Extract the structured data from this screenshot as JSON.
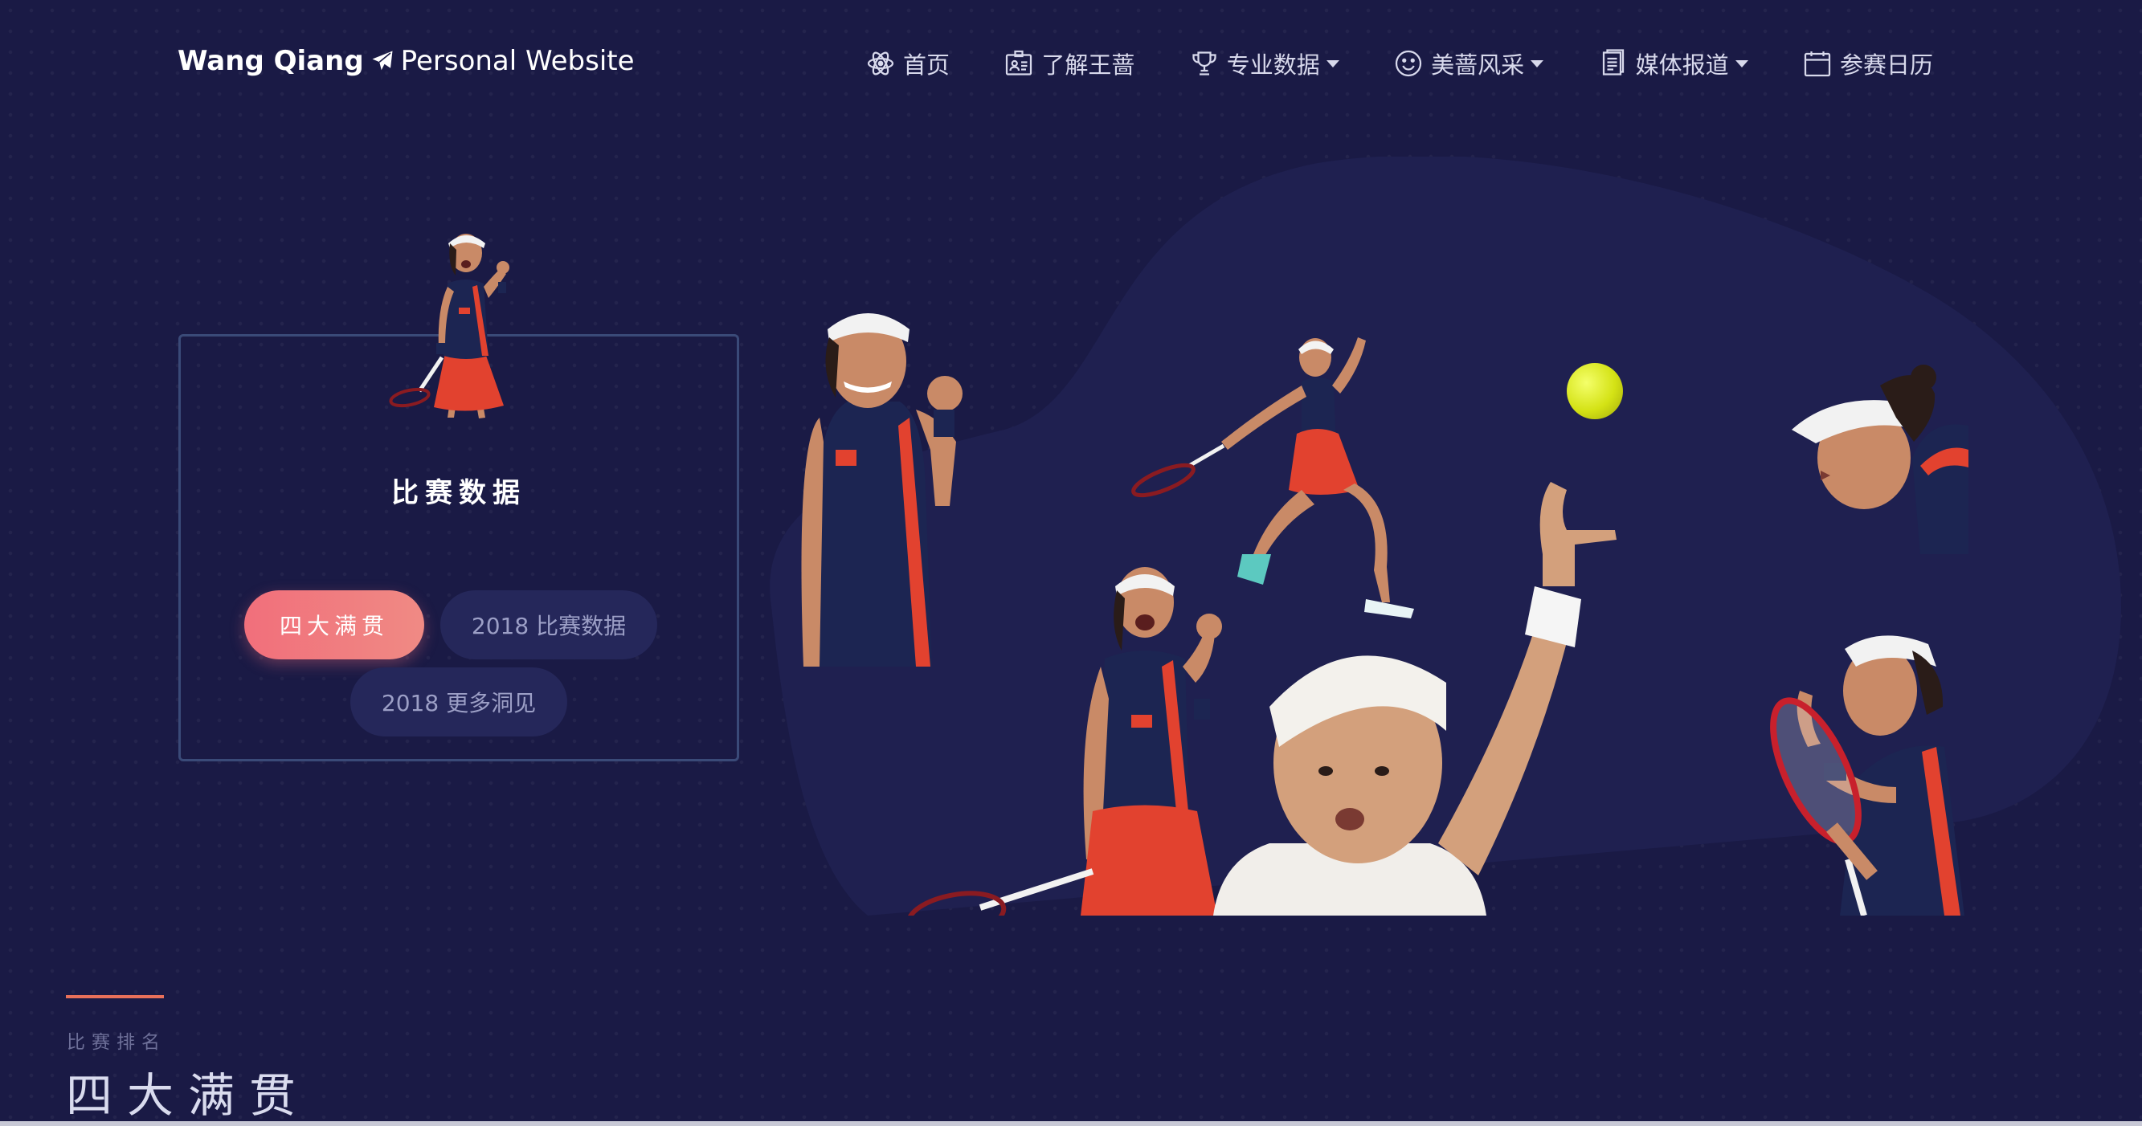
{
  "brand": {
    "name": "Wang Qiang",
    "subtitle": "Personal Website",
    "icon": "paper-plane-icon"
  },
  "nav": [
    {
      "label": "首页",
      "icon": "atom-icon",
      "dropdown": false
    },
    {
      "label": "了解王蔷",
      "icon": "id-card-icon",
      "dropdown": false
    },
    {
      "label": "专业数据",
      "icon": "trophy-icon",
      "dropdown": true
    },
    {
      "label": "美蔷风采",
      "icon": "smile-icon",
      "dropdown": true
    },
    {
      "label": "媒体报道",
      "icon": "document-icon",
      "dropdown": true
    },
    {
      "label": "参赛日历",
      "icon": "calendar-icon",
      "dropdown": false
    }
  ],
  "card": {
    "title": "比赛数据",
    "buttons": [
      {
        "label": "四大满贯",
        "active": true
      },
      {
        "label": "2018 比赛数据",
        "active": false
      },
      {
        "label": "2018 更多洞见",
        "active": false
      }
    ]
  },
  "section": {
    "subtitle": "比赛排名",
    "title": "四大满贯"
  },
  "colors": {
    "background": "#1a1a45",
    "accent": "#f16f7b",
    "blob": "#1f2050",
    "navy_kit": "#1c2552",
    "red_kit": "#e2422f"
  }
}
